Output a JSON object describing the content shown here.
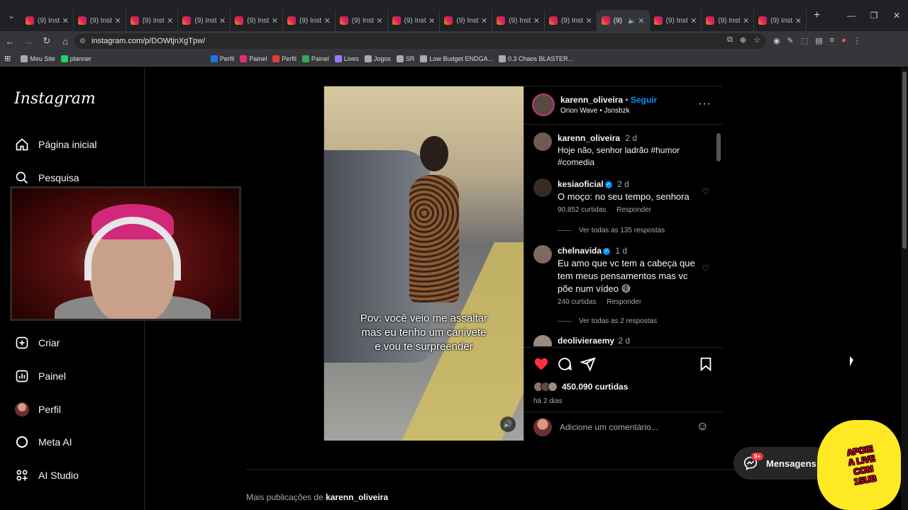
{
  "browser": {
    "tab_titles": [
      "(9) Inst",
      "(9) Inst",
      "(9) Inst",
      "(9) Inst",
      "(9) Inst",
      "(9) Inst",
      "(9) Inst",
      "(9) Inst",
      "(9) Inst",
      "(9) Inst",
      "(9) Inst",
      "(9)",
      "(9) Inst",
      "(9) Inst",
      "(9) Inst"
    ],
    "active_tab_index": 11,
    "url": "instagram.com/p/DOWtjnXgTpw/",
    "bookmarks": [
      "Meu Site",
      "planner",
      "Perfil",
      "Painel",
      "Perfil",
      "Painel",
      "Lives",
      "Jogos",
      "SR",
      "Low Budget ENDGA...",
      "0.3 Chaos BLASTER..."
    ]
  },
  "sidebar": {
    "logo": "Instagram",
    "items": [
      {
        "label": "Página inicial",
        "icon": "home-icon"
      },
      {
        "label": "Pesquisa",
        "icon": "search-icon"
      },
      {
        "label": "Criar",
        "icon": "create-icon"
      },
      {
        "label": "Painel",
        "icon": "dashboard-icon"
      },
      {
        "label": "Perfil",
        "icon": "profile-avatar"
      },
      {
        "label": "Meta AI",
        "icon": "meta-ai-icon"
      },
      {
        "label": "AI Studio",
        "icon": "ai-studio-icon"
      }
    ]
  },
  "post": {
    "author": "karenn_oliveira",
    "follow_label": "Seguir",
    "audio": "Orion Wave",
    "audio_sep": "•",
    "audio_author": "Jsnsbzk",
    "caption_overlay": [
      "Pov: você veio me assaltar",
      "mas eu tenho um canivete",
      "e vou te surpreender"
    ],
    "likes": "450.090 curtidas",
    "posted": "há 2 dias",
    "add_comment_placeholder": "Adicione um comentário..."
  },
  "comments": [
    {
      "user": "karenn_oliveira",
      "time": "2 d",
      "text": "Hoje não, senhor ladrão",
      "tags": "#humor #comedia"
    },
    {
      "user": "kesiaoficial",
      "verified": true,
      "time": "2 d",
      "text": "O moço: no seu tempo, senhora",
      "likes": "90.852 curtidas",
      "reply": "Responder",
      "view_replies": "Ver todas as 135 respostas"
    },
    {
      "user": "chelnavida",
      "verified": true,
      "time": "1 d",
      "text": "Eu amo que vc tem a cabeça que tem meus pensamentos mas vc põe num vídeo 😅",
      "likes": "240 curtidas",
      "reply": "Responder",
      "view_replies": "Ver todas as 2 respostas"
    },
    {
      "user": "deolivieraemy",
      "time": "2 d"
    }
  ],
  "footer": {
    "more_pubs_prefix": "Mais publicações de",
    "more_pubs_user": "karenn_oliveira"
  },
  "messages": {
    "label": "Mensagens",
    "badge": "9+"
  },
  "sticker": {
    "lines": [
      "APOIE",
      "A LIVE",
      "COM",
      "1SUB"
    ]
  },
  "colors": {
    "accent": "#0095f6",
    "like": "#ff3040",
    "bg": "#000000"
  }
}
